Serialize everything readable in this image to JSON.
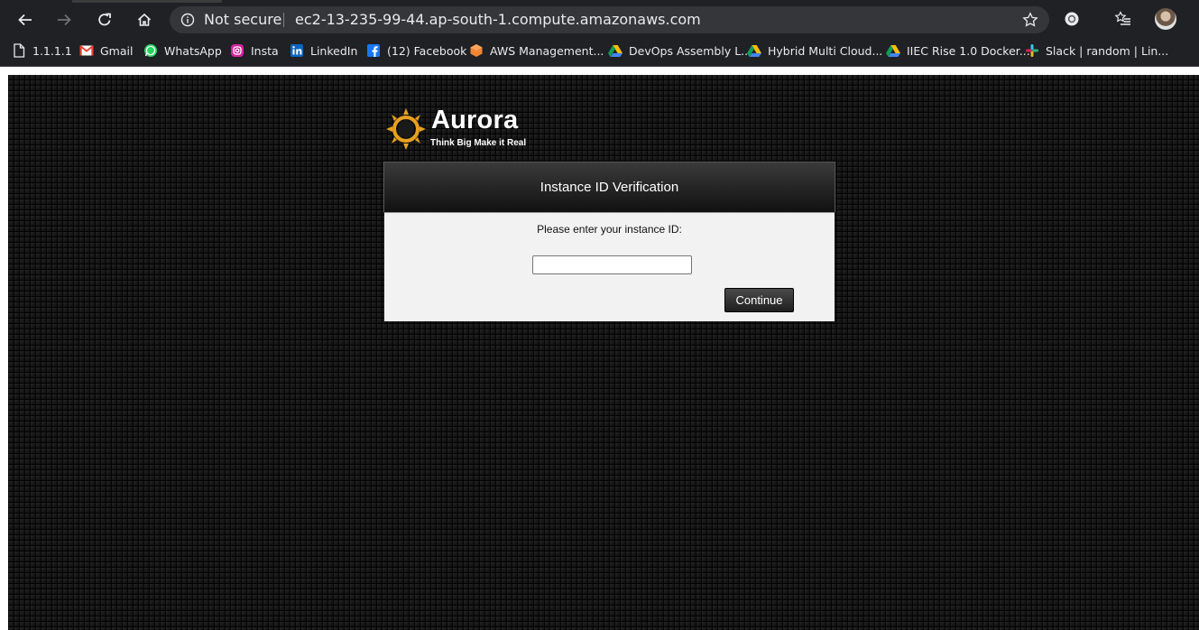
{
  "browser": {
    "security_label": "Not secure",
    "url": "ec2-13-235-99-44.ap-south-1.compute.amazonaws.com",
    "nav_icons": [
      "back-arrow-icon",
      "forward-arrow-icon",
      "reload-icon",
      "home-icon"
    ],
    "right_icons": [
      "bookmark-star-icon",
      "extension-icon",
      "reading-list-icon",
      "profile-avatar"
    ]
  },
  "bookmarks": [
    {
      "label": "1.1.1.1",
      "icon": "page-icon"
    },
    {
      "label": "Gmail",
      "icon": "gmail-icon"
    },
    {
      "label": "WhatsApp",
      "icon": "whatsapp-icon"
    },
    {
      "label": "Insta",
      "icon": "instagram-icon"
    },
    {
      "label": "LinkedIn",
      "icon": "linkedin-icon"
    },
    {
      "label": "(12) Facebook",
      "icon": "facebook-icon"
    },
    {
      "label": "AWS Management...",
      "icon": "aws-icon"
    },
    {
      "label": "DevOps Assembly L...",
      "icon": "google-drive-icon"
    },
    {
      "label": "Hybrid Multi Cloud...",
      "icon": "google-drive-icon"
    },
    {
      "label": "IIEC Rise 1.0 Docker...",
      "icon": "google-drive-icon"
    },
    {
      "label": "Slack | random | Lin...",
      "icon": "slack-icon"
    }
  ],
  "logo": {
    "name": "Aurora",
    "tagline": "Think Big Make it Real"
  },
  "panel": {
    "title": "Instance ID Verification",
    "prompt": "Please enter your instance ID:",
    "input_value": "",
    "button_label": "Continue"
  },
  "colors": {
    "chrome_bg": "#202124",
    "omnibox_bg": "#35363a",
    "page_bg": "#0c0c0c",
    "panel_body": "#f2f2f2",
    "logo_accent": "#e8a020"
  }
}
